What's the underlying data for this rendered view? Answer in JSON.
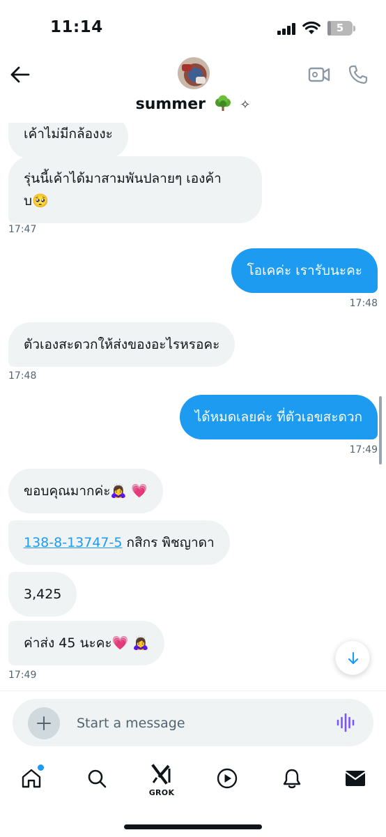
{
  "status_bar": {
    "time": "11:14",
    "battery_level": "5",
    "icons": [
      "cellular-signal-icon",
      "wifi-icon",
      "battery-icon"
    ]
  },
  "header": {
    "contact_name": "summer",
    "name_emoji": "tree-emoji",
    "name_sparkle": "✧",
    "icons": [
      "back-arrow-icon",
      "video-call-icon",
      "phone-call-icon"
    ]
  },
  "messages": [
    {
      "direction": "in",
      "text": "เค้าไม่มีกล้องงะ"
    },
    {
      "direction": "in",
      "line1": "รุ่นนี้เค้าได้มาสามพันปลายๆ เองค้า",
      "line2": "บ",
      "emoji": "🥺",
      "time": "17:47"
    },
    {
      "direction": "out",
      "text": "โอเคค่ะ เรารับนะคะ",
      "time": "17:48"
    },
    {
      "direction": "in",
      "text": "ตัวเองสะดวกให้ส่งของอะไรหรอคะ",
      "time": "17:48"
    },
    {
      "direction": "out",
      "text": "ได้หมดเลยค่ะ ที่ตัวเอขสะดวก",
      "time": "17:49"
    },
    {
      "direction": "in",
      "text": "ขอบคุณมากค่ะ",
      "emoji1": "🙇‍♀️",
      "emoji2": "💗"
    },
    {
      "direction": "in",
      "link": "138-8-13747-5",
      "text": " กสิกร พิชญาดา"
    },
    {
      "direction": "in",
      "text": "3,425"
    },
    {
      "direction": "in",
      "text": "ค่าส่ง 45 นะคะ",
      "emoji1": "💗",
      "emoji2": "🙇‍♀️",
      "time": "17:49"
    }
  ],
  "composer": {
    "placeholder": "Start a message",
    "icons": [
      "plus-icon",
      "voice-wave-icon"
    ]
  },
  "scroll_down_icon": "arrow-down-icon",
  "bottom_nav": {
    "items": [
      {
        "icon": "home-icon",
        "has_notification": true
      },
      {
        "icon": "search-icon"
      },
      {
        "icon": "grok-icon",
        "label": "GROK"
      },
      {
        "icon": "video-play-icon"
      },
      {
        "icon": "bell-icon"
      },
      {
        "icon": "mail-icon",
        "selected": true
      }
    ]
  },
  "colors": {
    "accent": "#1d9bf0",
    "incoming_bubble": "#eff3f4",
    "timestamp": "#536471",
    "voice_icon": "#7856ff"
  }
}
